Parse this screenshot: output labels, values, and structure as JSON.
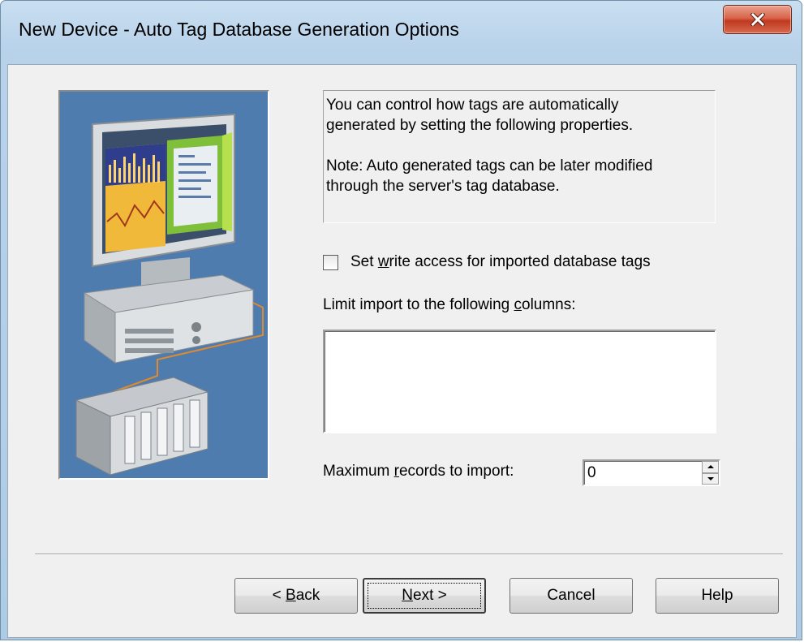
{
  "window": {
    "title": "New Device - Auto Tag Database Generation Options",
    "close_icon": "close-x-icon"
  },
  "illustration": {
    "icon": "computer-plc-network-illustration",
    "background_color": "#4f7cae"
  },
  "info": {
    "line1": "You can control how tags are automatically",
    "line2": "generated by setting the following properties.",
    "line3": "Note: Auto generated tags can be later modified",
    "line4": "through the server's tag database."
  },
  "options": {
    "write_access_pre": "Set ",
    "write_access_mnemonic": "w",
    "write_access_post": "rite access for imported database tags",
    "write_access_checked": false,
    "limit_pre": "Limit import to the following ",
    "limit_mnemonic": "c",
    "limit_post": "olumns:",
    "max_pre": "Maximum ",
    "max_mnemonic": "r",
    "max_post": "ecords to import:",
    "max_value": "0"
  },
  "buttons": {
    "back_pre": "< ",
    "back_mnemonic": "B",
    "back_post": "ack",
    "next_mnemonic": "N",
    "next_post": "ext >",
    "cancel": "Cancel",
    "help": "Help"
  }
}
